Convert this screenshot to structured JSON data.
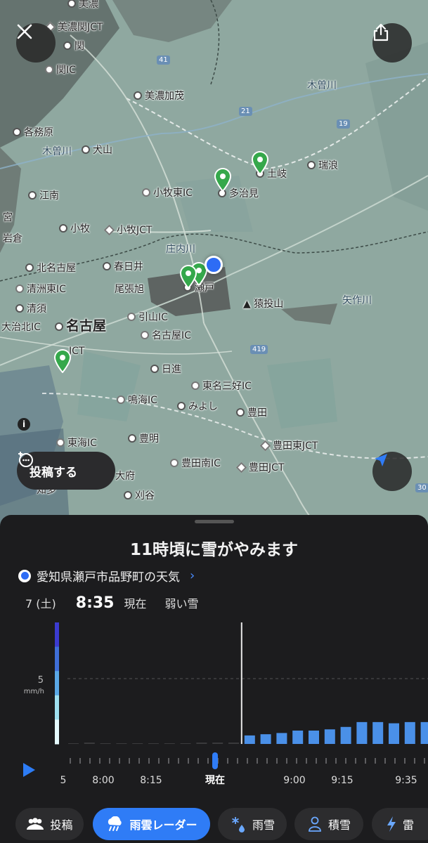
{
  "map": {
    "labels": [
      {
        "text": "美濃",
        "kind": "dot"
      },
      {
        "text": "美濃関JCT",
        "kind": "jct"
      },
      {
        "text": "関",
        "kind": "dot"
      },
      {
        "text": "関IC",
        "kind": "ic"
      },
      {
        "text": "美濃加茂",
        "kind": "dot"
      },
      {
        "text": "木曽川",
        "kind": "river"
      },
      {
        "text": "各務原",
        "kind": "dot"
      },
      {
        "text": "木曽川",
        "kind": "river"
      },
      {
        "text": "犬山",
        "kind": "dot"
      },
      {
        "text": "土岐",
        "kind": "dot"
      },
      {
        "text": "瑞浪",
        "kind": "dot"
      },
      {
        "text": "江南",
        "kind": "dot"
      },
      {
        "text": "小牧東IC",
        "kind": "ic"
      },
      {
        "text": "多治見",
        "kind": "dot"
      },
      {
        "text": "宮",
        "kind": "none"
      },
      {
        "text": "小牧",
        "kind": "dot"
      },
      {
        "text": "小牧JCT",
        "kind": "jct"
      },
      {
        "text": "岩倉",
        "kind": "none"
      },
      {
        "text": "庄内川",
        "kind": "river"
      },
      {
        "text": "北名古屋",
        "kind": "dot"
      },
      {
        "text": "春日井",
        "kind": "dot"
      },
      {
        "text": "清洲東IC",
        "kind": "ic"
      },
      {
        "text": "尾張旭",
        "kind": "none"
      },
      {
        "text": "瀬戸",
        "kind": "dot"
      },
      {
        "text": "猿投山",
        "kind": "mountain"
      },
      {
        "text": "矢作川",
        "kind": "river"
      },
      {
        "text": "清須",
        "kind": "dot"
      },
      {
        "text": "引山IC",
        "kind": "ic"
      },
      {
        "text": "大治北IC",
        "kind": "none"
      },
      {
        "text": "名古屋",
        "kind": "dot"
      },
      {
        "text": "名古屋IC",
        "kind": "ic"
      },
      {
        "text": "JCT",
        "kind": "none"
      },
      {
        "text": "日進",
        "kind": "dot"
      },
      {
        "text": "東名三好IC",
        "kind": "ic"
      },
      {
        "text": "鳴海IC",
        "kind": "ic"
      },
      {
        "text": "みよし",
        "kind": "dot"
      },
      {
        "text": "豊田",
        "kind": "dot"
      },
      {
        "text": "東海IC",
        "kind": "ic"
      },
      {
        "text": "豊明",
        "kind": "dot"
      },
      {
        "text": "豊田東JCT",
        "kind": "jct"
      },
      {
        "text": "豊田南IC",
        "kind": "ic"
      },
      {
        "text": "豊田JCT",
        "kind": "jct"
      },
      {
        "text": "大府",
        "kind": "none"
      },
      {
        "text": "刈谷",
        "kind": "dot"
      },
      {
        "text": "知多",
        "kind": "none"
      }
    ],
    "road_numbers": [
      "41",
      "21",
      "19",
      "419",
      "30"
    ],
    "close_icon": "close-icon",
    "share_icon": "share-icon",
    "post_button_label": "投稿する",
    "locate_icon": "navigation-arrow-icon"
  },
  "sheet": {
    "headline": "11時頃に雪がやみます",
    "location": "愛知県瀬戸市品野町の天気",
    "date": "7 (土)",
    "time": "8:35",
    "now_label": "現在",
    "condition": "弱い雪"
  },
  "chart_data": {
    "type": "bar",
    "title": "",
    "ylabel": "mm/h",
    "yticks": [
      5
    ],
    "y_ref_label": "5",
    "y_unit": "mm/h",
    "ylim": [
      0,
      10
    ],
    "legend_scale": [
      "#3b3bd0",
      "#3f6fd8",
      "#5aa8e6",
      "#9fe0f0",
      "#e6fbff"
    ],
    "values": [
      0.0,
      0.1,
      0.0,
      0.0,
      0.0,
      0.0,
      0.0,
      0.0,
      0.1,
      0.1,
      0.1,
      0.7,
      0.8,
      0.9,
      1.1,
      1.1,
      1.2,
      1.4,
      1.8,
      1.8,
      1.7,
      1.8,
      1.8,
      1.8,
      1.4,
      0.7
    ],
    "past_count": 11,
    "now_index": 11,
    "grid": false
  },
  "scrubber": {
    "ticks": [
      "5",
      "8:00",
      "8:15",
      "現在",
      "9:00",
      "9:15",
      "9:35"
    ]
  },
  "tabs": [
    {
      "label": "投稿",
      "icon": "people-icon",
      "active": false
    },
    {
      "label": "雨雲レーダー",
      "icon": "rain-cloud-icon",
      "active": true
    },
    {
      "label": "雨雪",
      "icon": "snow-rain-icon",
      "active": false
    },
    {
      "label": "積雪",
      "icon": "snow-accumulation-icon",
      "active": false
    },
    {
      "label": "雷",
      "icon": "lightning-icon",
      "active": false
    }
  ]
}
